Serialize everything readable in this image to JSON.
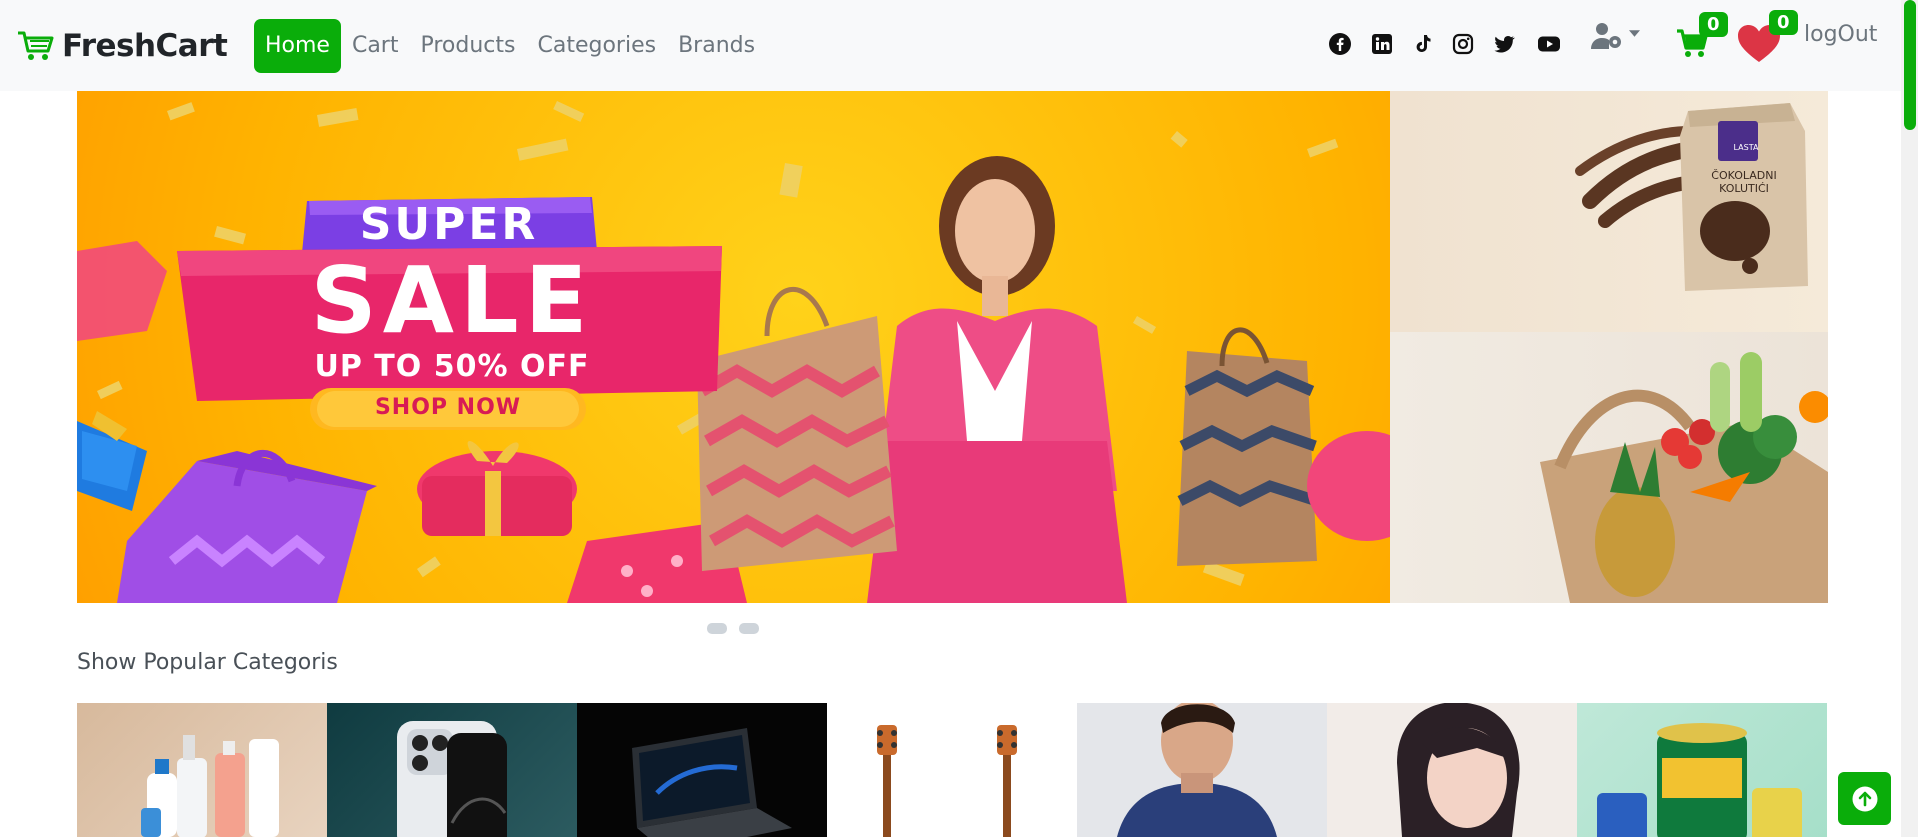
{
  "brand": {
    "name": "FreshCart"
  },
  "nav": {
    "links": [
      "Home",
      "Cart",
      "Products",
      "Categories",
      "Brands"
    ],
    "active": "Home"
  },
  "social_icons": [
    "facebook-icon",
    "linkedin-icon",
    "tiktok-icon",
    "instagram-icon",
    "twitter-icon",
    "youtube-icon"
  ],
  "cart": {
    "count": "0"
  },
  "wishlist": {
    "count": "0"
  },
  "account": {
    "logout_label": "logOut"
  },
  "banner": {
    "line1": "SUPER",
    "line2": "SALE",
    "line3": "UP TO 50% OFF",
    "cta": "SHOP NOW",
    "product_bag_brand": "LASTA",
    "product_bag_title": "ČOKOLADNI KOLUTIĆI"
  },
  "section": {
    "title": "Show Popular Categoris"
  },
  "categories": [
    "cosmetics",
    "mobiles",
    "laptops",
    "music",
    "men-fashion",
    "women-fashion",
    "supermarket"
  ],
  "colors": {
    "accent": "#0aad0a",
    "navbar_bg": "#f8f9fa",
    "banner_bg": "#ffb300",
    "sale_pink": "#e8266a",
    "super_purple": "#7b3fe4"
  }
}
